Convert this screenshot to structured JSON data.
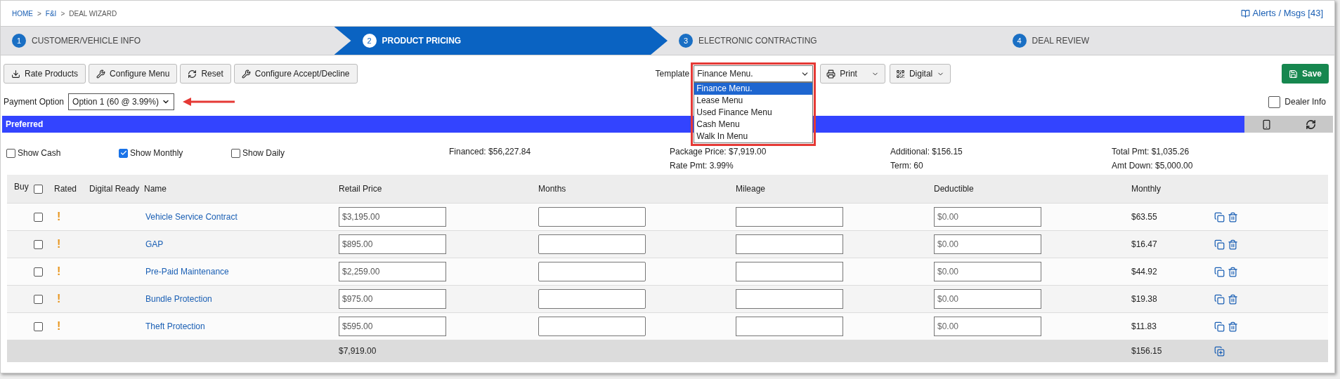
{
  "breadcrumb": [
    {
      "label": "HOME",
      "current": false
    },
    {
      "label": "F&I",
      "current": false
    },
    {
      "label": "DEAL WIZARD",
      "current": true
    }
  ],
  "breadcrumb_separator": ">",
  "alerts": "Alerts / Msgs [43]",
  "steps": [
    {
      "number": "1",
      "label": "CUSTOMER/VEHICLE INFO",
      "selected": false
    },
    {
      "number": "2",
      "label": "PRODUCT PRICING",
      "selected": true
    },
    {
      "number": "3",
      "label": "ELECTRONIC CONTRACTING",
      "selected": false
    },
    {
      "number": "4",
      "label": "DEAL REVIEW",
      "selected": false
    }
  ],
  "toolbar": [
    {
      "label": "Rate Products",
      "kind": "download"
    },
    {
      "label": "Configure Menu",
      "kind": "wrench"
    },
    {
      "label": "Reset",
      "kind": "refresh"
    },
    {
      "label": "Configure Accept/Decline",
      "kind": "wrench"
    }
  ],
  "template": {
    "label": "Template",
    "value": "Finance Menu.",
    "expanded": true,
    "options": [
      {
        "label": "Finance Menu.",
        "selected": true
      },
      {
        "label": "Lease Menu",
        "selected": false
      },
      {
        "label": "Used Finance Menu",
        "selected": false
      },
      {
        "label": "Cash Menu",
        "selected": false
      },
      {
        "label": "Walk In Menu",
        "selected": false
      }
    ]
  },
  "print_button": "Print",
  "digital_button": "Digital",
  "save_button": "Save",
  "payment_option": {
    "label": "Payment Option",
    "value": "Option 1 (60 @ 3.99%)"
  },
  "dealer_info": {
    "label": "Dealer Info",
    "checked": false
  },
  "banner": {
    "title": "Preferred"
  },
  "display_toggles": [
    {
      "label": "Show Cash",
      "checked": false
    },
    {
      "label": "Show Monthly",
      "checked": true
    },
    {
      "label": "Show Daily",
      "checked": false
    }
  ],
  "summary_row_1": [
    "Financed: $56,227.84",
    "Package Price: $7,919.00",
    "Additional: $156.15",
    "Total Pmt: $1,035.26"
  ],
  "summary_row_2": [
    "Rate Pmt: 3.99%",
    "Term: 60",
    "Amt Down: $5,000.00"
  ],
  "table": {
    "columns": [
      "Buy",
      "Rated",
      "Digital Ready",
      "Name",
      "Retail Price",
      "Months",
      "Mileage",
      "Deductible",
      "Monthly"
    ],
    "select_all_checked": false,
    "rows": [
      {
        "checked": false,
        "rated": "!",
        "name": "Vehicle Service Contract",
        "retail_price": "$3,195.00",
        "deductible": "$0.00",
        "monthly": "$63.55"
      },
      {
        "checked": false,
        "rated": "!",
        "name": "GAP",
        "retail_price": "$895.00",
        "deductible": "$0.00",
        "monthly": "$16.47"
      },
      {
        "checked": false,
        "rated": "!",
        "name": "Pre-Paid Maintenance",
        "retail_price": "$2,259.00",
        "deductible": "$0.00",
        "monthly": "$44.92"
      },
      {
        "checked": false,
        "rated": "!",
        "name": "Bundle Protection",
        "retail_price": "$975.00",
        "deductible": "$0.00",
        "monthly": "$19.38"
      },
      {
        "checked": false,
        "rated": "!",
        "name": "Theft Protection",
        "retail_price": "$595.00",
        "deductible": "$0.00",
        "monthly": "$11.83"
      }
    ],
    "totals": {
      "retail_price": "$7,919.00",
      "monthly": "$156.15"
    }
  }
}
